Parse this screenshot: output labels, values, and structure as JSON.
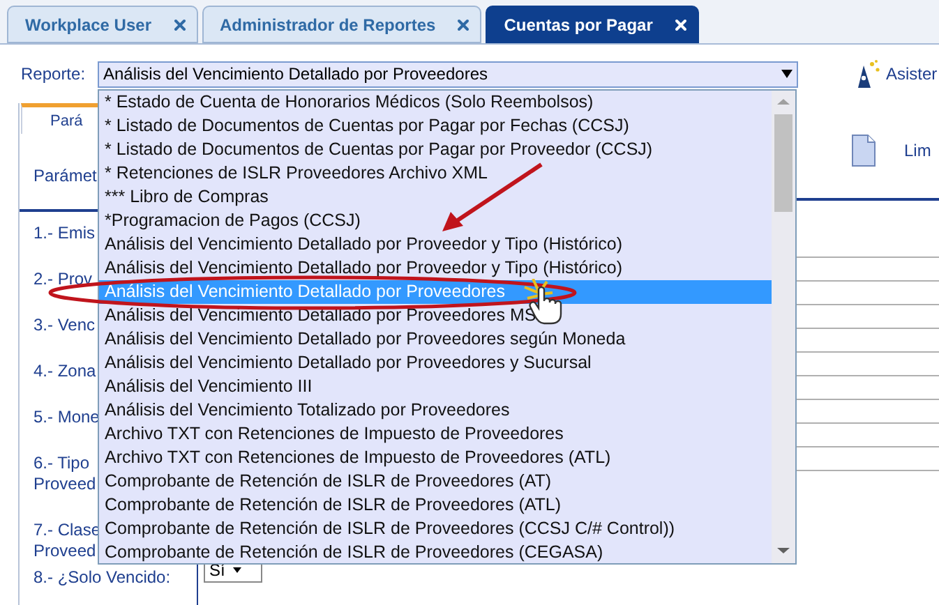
{
  "tabs": [
    {
      "label": "Workplace User",
      "selected": false
    },
    {
      "label": "Administrador de Reportes",
      "selected": false
    },
    {
      "label": "Cuentas por Pagar",
      "selected": true
    }
  ],
  "report": {
    "label": "Reporte:",
    "value": "Análisis del Vencimiento Detallado por Proveedores"
  },
  "assistant": {
    "label": "Asister"
  },
  "dropdown": {
    "options": [
      {
        "label": "* Estado de Cuenta de Honorarios Médicos (Solo Reembolsos)",
        "selected": false
      },
      {
        "label": "* Listado de Documentos de Cuentas por Pagar por Fechas (CCSJ)",
        "selected": false
      },
      {
        "label": "* Listado de Documentos de Cuentas por Pagar por Proveedor (CCSJ)",
        "selected": false
      },
      {
        "label": "* Retenciones de ISLR Proveedores Archivo XML",
        "selected": false
      },
      {
        "label": "*** Libro de Compras",
        "selected": false
      },
      {
        "label": "*Programacion de Pagos (CCSJ)",
        "selected": false
      },
      {
        "label": "Análisis del Vencimiento Detallado por Proveedor y Tipo (Histórico)",
        "selected": false
      },
      {
        "label": "Análisis del Vencimiento Detallado por Proveedor y Tipo (Histórico)",
        "selected": false
      },
      {
        "label": "Análisis del Vencimiento Detallado por Proveedores",
        "selected": true
      },
      {
        "label": "Análisis del Vencimiento Detallado por Proveedores MS",
        "selected": false
      },
      {
        "label": "Análisis del Vencimiento Detallado por Proveedores según Moneda",
        "selected": false
      },
      {
        "label": "Análisis del Vencimiento Detallado por Proveedores y Sucursal",
        "selected": false
      },
      {
        "label": "Análisis del Vencimiento III",
        "selected": false
      },
      {
        "label": "Análisis del Vencimiento Totalizado por Proveedores",
        "selected": false
      },
      {
        "label": "Archivo TXT con Retenciones de Impuesto de Proveedores",
        "selected": false
      },
      {
        "label": "Archivo TXT con Retenciones de Impuesto de Proveedores (ATL)",
        "selected": false
      },
      {
        "label": "Comprobante de Retención de ISLR de Proveedores (AT)",
        "selected": false
      },
      {
        "label": "Comprobante de Retención de ISLR de Proveedores (ATL)",
        "selected": false
      },
      {
        "label": "Comprobante de Retención de ISLR de Proveedores (CCSJ C/# Control))",
        "selected": false
      },
      {
        "label": "Comprobante de Retención de ISLR de Proveedores (CEGASA)",
        "selected": false
      }
    ]
  },
  "panel": {
    "tab": "Pará",
    "header": "Parámet",
    "params": [
      {
        "lines": [
          "1.- Emis"
        ]
      },
      {
        "lines": [
          "2.- Prov"
        ]
      },
      {
        "lines": [
          "3.- Venc"
        ]
      },
      {
        "lines": [
          "4.- Zona"
        ]
      },
      {
        "lines": [
          "5.- Mone"
        ]
      },
      {
        "lines": [
          "6.- Tipo",
          "Proveed"
        ]
      },
      {
        "lines": [
          "7.- Clase",
          "Proveed"
        ]
      }
    ],
    "solo": {
      "label": "8.- ¿Solo Vencido:",
      "value": "Sí"
    }
  },
  "right": {
    "label": "Lim"
  }
}
